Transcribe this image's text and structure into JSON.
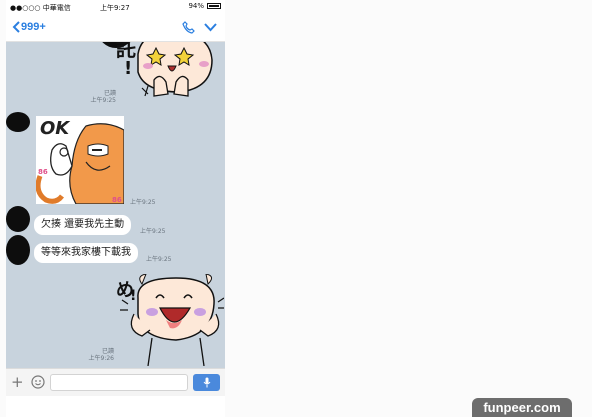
{
  "status_bar": {
    "carrier": "●●○○○ 中華電信 ",
    "time": "上午9:27",
    "battery": "94%"
  },
  "nav": {
    "back_label": "999+"
  },
  "chat": {
    "read_1": "已讀",
    "time_1": "上午9:25",
    "sticker_text_ok": "OK",
    "time_2": "上午9:25",
    "message_1": "欠揍  還要我先主動",
    "time_3": "上午9:25",
    "message_2": "等等來我家樓下載我",
    "time_4": "上午9:25",
    "read_2": "已讀",
    "time_5": "上午9:26"
  },
  "input": {
    "placeholder": ""
  },
  "watermark": "funpeer.com"
}
